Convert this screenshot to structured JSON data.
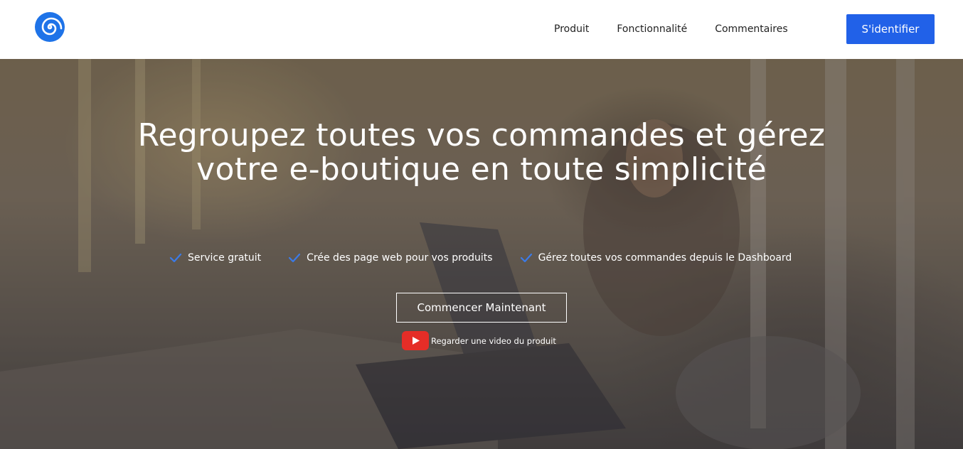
{
  "brand": {
    "logo_icon": "spiral-logo-icon",
    "accent_color": "#2161e8"
  },
  "nav": {
    "items": [
      {
        "label": "Produit"
      },
      {
        "label": "Fonctionnalité"
      },
      {
        "label": "Commentaires"
      }
    ],
    "signin_label": "S'identifier"
  },
  "hero": {
    "title": "Regroupez toutes vos commandes et gérez votre e-boutique en toute simplicité",
    "features": [
      {
        "icon": "check-icon",
        "label": "Service gratuit"
      },
      {
        "icon": "check-icon",
        "label": "Crée des page web pour vos produits"
      },
      {
        "icon": "check-icon",
        "label": "Gérez toutes vos commandes depuis le Dashboard"
      }
    ],
    "cta_label": "Commencer Maintenant",
    "video": {
      "icon": "youtube-play-icon",
      "label": "Regarder une video du produit"
    }
  }
}
